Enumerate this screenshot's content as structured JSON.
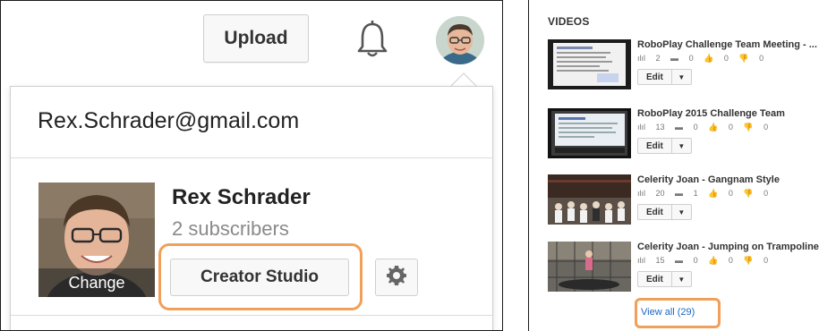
{
  "header": {
    "upload_label": "Upload",
    "bell_icon": "bell-icon",
    "avatar_icon": "user-avatar"
  },
  "account_menu": {
    "email": "Rex.Schrader@gmail.com",
    "channel_name": "Rex Schrader",
    "subscribers": "2 subscribers",
    "change_label": "Change",
    "creator_studio_label": "Creator Studio",
    "settings_icon": "gear-icon"
  },
  "videos_panel": {
    "heading": "VIDEOS",
    "videos": [
      {
        "title": "RoboPlay Challenge Team Meeting - ...",
        "views": "2",
        "comments": "0",
        "likes": "0",
        "dislikes": "0",
        "edit_label": "Edit"
      },
      {
        "title": "RoboPlay 2015 Challenge Team",
        "views": "13",
        "comments": "0",
        "likes": "0",
        "dislikes": "0",
        "edit_label": "Edit"
      },
      {
        "title": "Celerity Joan - Gangnam Style",
        "views": "20",
        "comments": "1",
        "likes": "0",
        "dislikes": "0",
        "edit_label": "Edit"
      },
      {
        "title": "Celerity Joan - Jumping on Trampoline",
        "views": "15",
        "comments": "0",
        "likes": "0",
        "dislikes": "0",
        "edit_label": "Edit"
      }
    ],
    "view_all_label": "View all (29)"
  },
  "colors": {
    "highlight": "#f0a05a",
    "link": "#1a66c4"
  }
}
